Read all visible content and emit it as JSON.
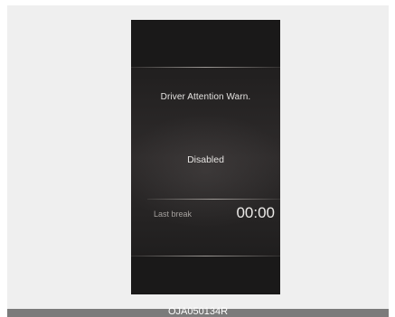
{
  "display": {
    "title": "Driver Attention Warn.",
    "status": "Disabled",
    "last_break_label": "Last break",
    "last_break_value": "00:00"
  },
  "caption": {
    "code": "OJA050134R"
  },
  "colors": {
    "background": "#efefef",
    "display_dark": "#1b1a1a",
    "text_primary": "#e6e4e2",
    "text_secondary": "#a4a09d",
    "caption_bar": "#7b7b7b"
  }
}
